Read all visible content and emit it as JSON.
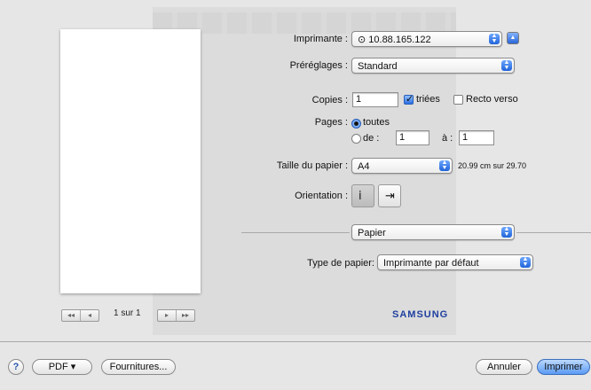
{
  "printer": {
    "label": "Imprimante :",
    "value": "⊙ 10.88.165.122"
  },
  "presets": {
    "label": "Préréglages :",
    "value": "Standard"
  },
  "copies": {
    "label": "Copies :",
    "value": "1",
    "collated_label": "triées",
    "collated": true,
    "duplex_label": "Recto verso",
    "duplex": false
  },
  "pages": {
    "label": "Pages :",
    "all_label": "toutes",
    "from_label": "de :",
    "from_value": "1",
    "to_label": "à :",
    "to_value": "1",
    "selected": "toutes"
  },
  "paper_size": {
    "label": "Taille du papier :",
    "value": "A4",
    "dimensions": "20.99 cm sur 29.70"
  },
  "orientation": {
    "label": "Orientation :",
    "options": [
      "portrait-icon",
      "landscape-icon"
    ],
    "selected": "portrait-icon"
  },
  "section": {
    "value": "Papier"
  },
  "paper_type": {
    "label": "Type de papier:",
    "value": "Imprimante par défaut"
  },
  "preview": {
    "page_indicator": "1 sur 1",
    "nav_prev": [
      "◂◂",
      "◂"
    ],
    "nav_next": [
      "▸",
      "▸▸"
    ]
  },
  "vendor": {
    "logo_text": "SAMSUNG"
  },
  "footer": {
    "help_label": "?",
    "pdf_label": "PDF ▾",
    "supplies_label": "Fournitures...",
    "cancel_label": "Annuler",
    "print_label": "Imprimer"
  },
  "colors": {
    "accent": "#2a6fe0",
    "background": "#e6e6e6",
    "logo": "#1f3fa0"
  }
}
